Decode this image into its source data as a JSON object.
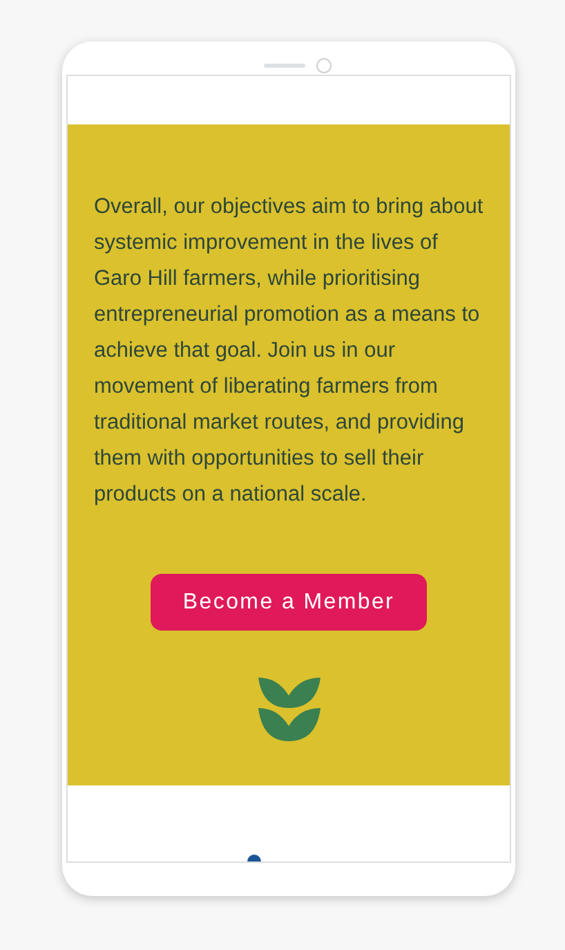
{
  "content": {
    "paragraph": "Overall, our objectives aim to bring about systemic improvement in the lives of Garo Hill farmers, while prioritising entrepreneurial promotion as a means to achieve that goal. Join us in our movement of liberating farmers from traditional market routes, and providing them with opportunities to sell their products on a national scale.",
    "button": {
      "label": "Become a Member"
    }
  }
}
